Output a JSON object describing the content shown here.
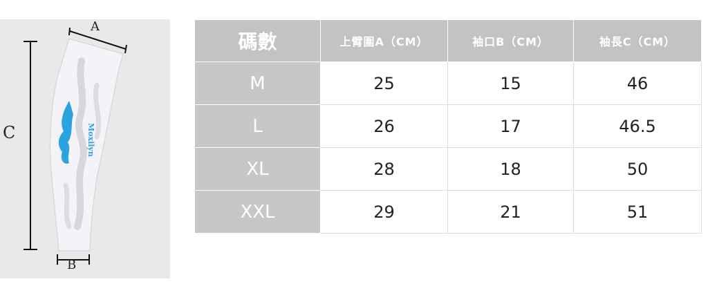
{
  "diagram": {
    "labels": {
      "a": "A",
      "b": "B",
      "c": "C"
    },
    "accent_color": "#2aa3e0"
  },
  "table": {
    "headers": [
      "碼數",
      "上臂圍A（CM）",
      "袖口B（CM）",
      "袖長C（CM）"
    ],
    "rows": [
      {
        "size": "M",
        "a": "25",
        "b": "15",
        "c": "46"
      },
      {
        "size": "L",
        "a": "26",
        "b": "17",
        "c": "46.5"
      },
      {
        "size": "XL",
        "a": "28",
        "b": "18",
        "c": "50"
      },
      {
        "size": "XXL",
        "a": "29",
        "b": "21",
        "c": "51"
      }
    ]
  }
}
